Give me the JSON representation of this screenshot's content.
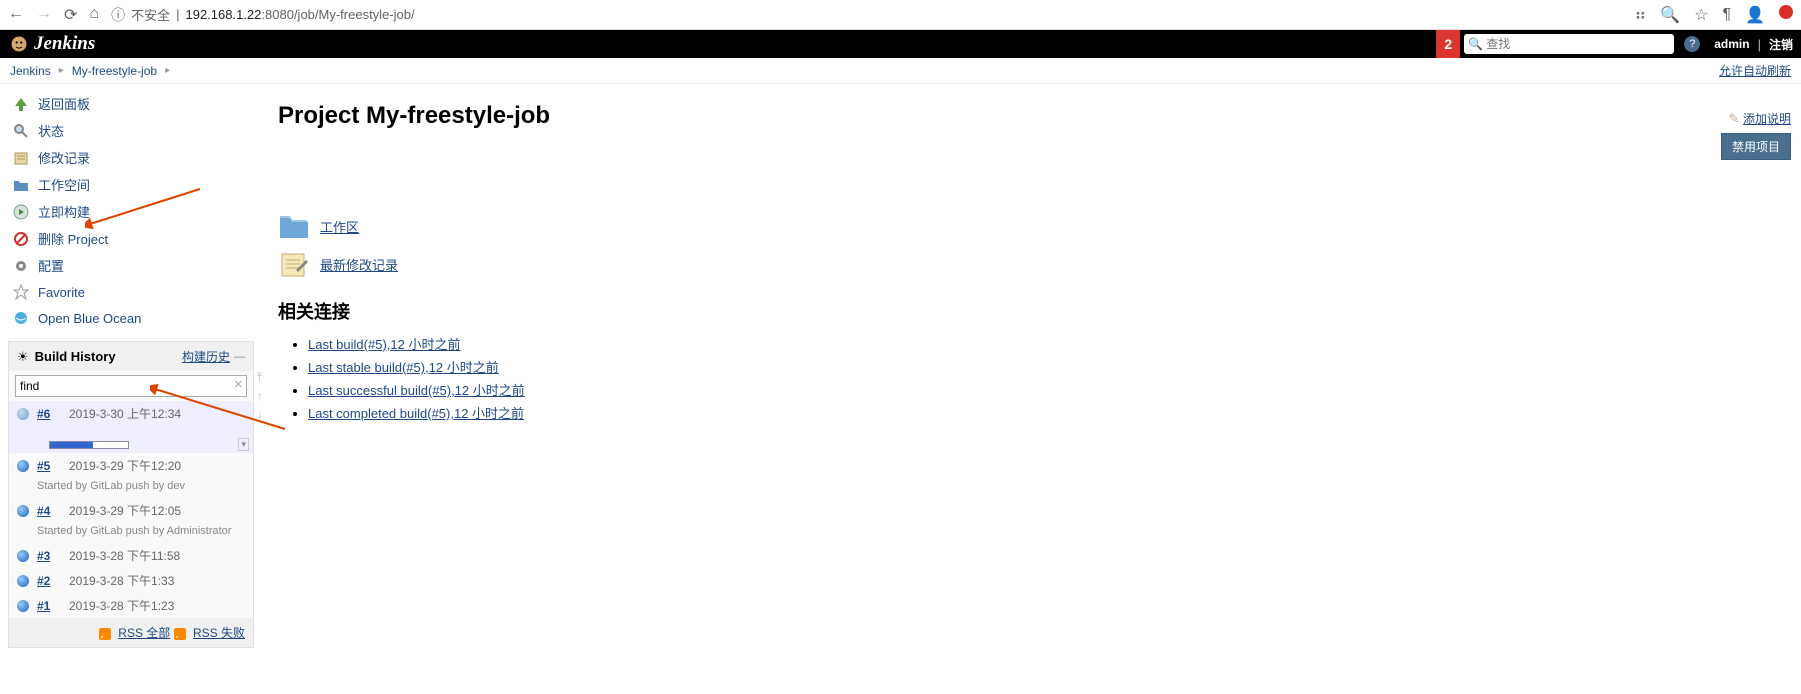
{
  "browser": {
    "insecure_label": "不安全",
    "url_host": "192.168.1.22",
    "url_port": ":8080",
    "url_path": "/job/My-freestyle-job/"
  },
  "header": {
    "brand": "Jenkins",
    "notif_count": "2",
    "search_placeholder": "查找",
    "user": "admin",
    "logout": "注销"
  },
  "breadcrumb": {
    "root": "Jenkins",
    "job": "My-freestyle-job",
    "auto_refresh": "允许自动刷新"
  },
  "sidebar": {
    "items": [
      {
        "label": "返回面板"
      },
      {
        "label": "状态"
      },
      {
        "label": "修改记录"
      },
      {
        "label": "工作空间"
      },
      {
        "label": "立即构建"
      },
      {
        "label": "删除 Project"
      },
      {
        "label": "配置"
      },
      {
        "label": "Favorite"
      },
      {
        "label": "Open Blue Ocean"
      }
    ]
  },
  "build_history": {
    "title": "Build History",
    "trend_label": "构建历史",
    "filter_value": "find",
    "builds": [
      {
        "num": "#6",
        "date": "2019-3-30 上午12:34",
        "running": true,
        "progress_pct": 55
      },
      {
        "num": "#5",
        "date": "2019-3-29 下午12:20",
        "cause": "Started by GitLab push by dev"
      },
      {
        "num": "#4",
        "date": "2019-3-29 下午12:05",
        "cause": "Started by GitLab push by Administrator"
      },
      {
        "num": "#3",
        "date": "2019-3-28 下午11:58"
      },
      {
        "num": "#2",
        "date": "2019-3-28 下午1:33"
      },
      {
        "num": "#1",
        "date": "2019-3-28 下午1:23"
      }
    ],
    "rss_all": "RSS 全部",
    "rss_fail": "RSS 失败"
  },
  "content": {
    "title": "Project My-freestyle-job",
    "add_description": "添加说明",
    "disable_button": "禁用项目",
    "workspace_link": "工作区",
    "changes_link": "最新修改记录",
    "permalinks_title": "相关连接",
    "permalinks": [
      "Last build(#5),12 小时之前",
      "Last stable build(#5),12 小时之前",
      "Last successful build(#5),12 小时之前",
      "Last completed build(#5),12 小时之前"
    ]
  }
}
